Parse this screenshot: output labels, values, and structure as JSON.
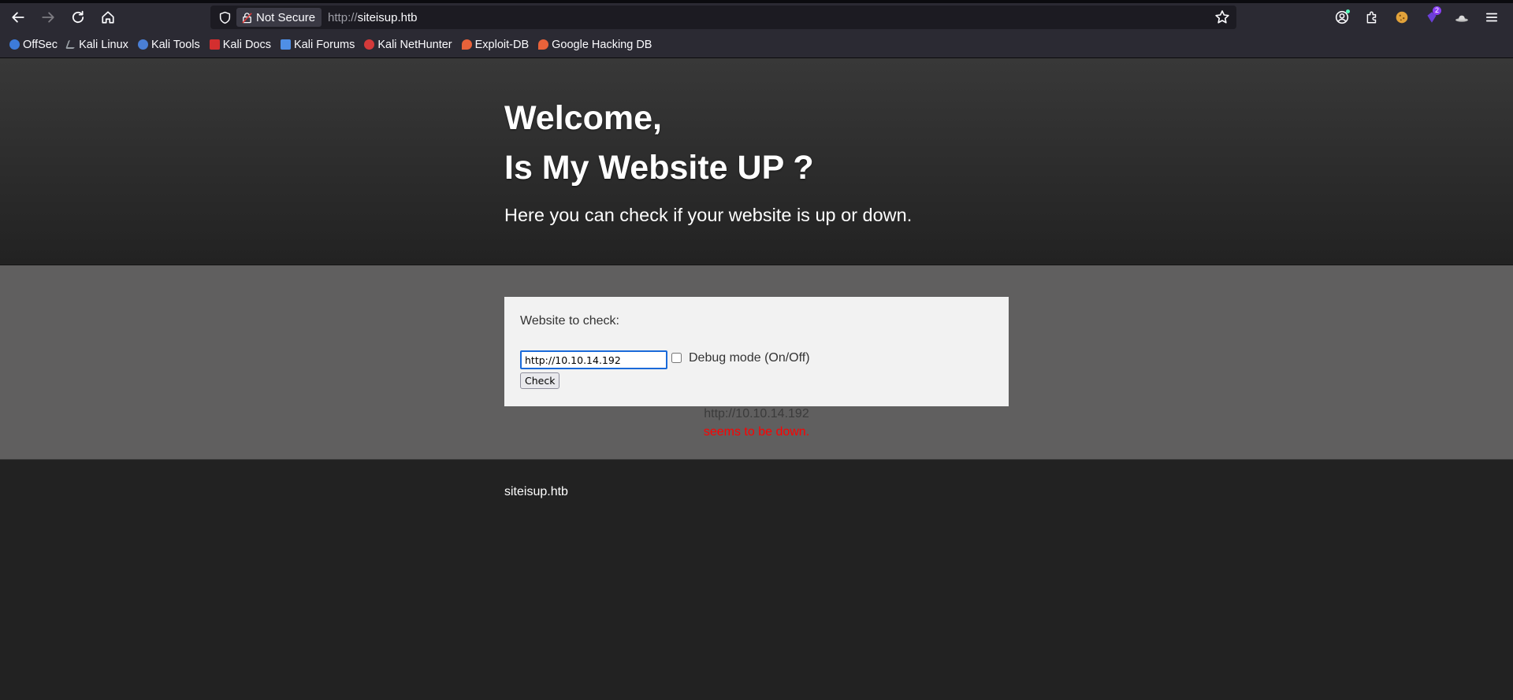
{
  "browser": {
    "security_label": "Not Secure",
    "url_scheme": "http://",
    "url_host": "siteisup.htb",
    "extension_badge": "2"
  },
  "bookmarks": [
    {
      "label": "OffSec",
      "icon": "offsec-icon",
      "color": "#3d7bd9"
    },
    {
      "label": "Kali Linux",
      "icon": "kali-dragon-icon",
      "color": "#9aa0a6"
    },
    {
      "label": "Kali Tools",
      "icon": "kali-tools-icon",
      "color": "#4a7fd6"
    },
    {
      "label": "Kali Docs",
      "icon": "kali-docs-icon",
      "color": "#d32f2f"
    },
    {
      "label": "Kali Forums",
      "icon": "kali-forums-icon",
      "color": "#4f8fe6"
    },
    {
      "label": "Kali NetHunter",
      "icon": "nethunter-icon",
      "color": "#d33a3a"
    },
    {
      "label": "Exploit-DB",
      "icon": "exploitdb-icon",
      "color": "#e8623a"
    },
    {
      "label": "Google Hacking DB",
      "icon": "ghdb-icon",
      "color": "#e8623a"
    }
  ],
  "hero": {
    "title_line1": "Welcome,",
    "title_line2": "Is My Website UP ?",
    "lead": "Here you can check if your website is up or down."
  },
  "form": {
    "label": "Website to check:",
    "input_value": "http://10.10.14.192",
    "debug_label": "Debug mode (On/Off)",
    "debug_checked": false,
    "check_button": "Check"
  },
  "result": {
    "url": "http://10.10.14.192",
    "status": "seems to be down."
  },
  "footer": {
    "text": "siteisup.htb"
  }
}
